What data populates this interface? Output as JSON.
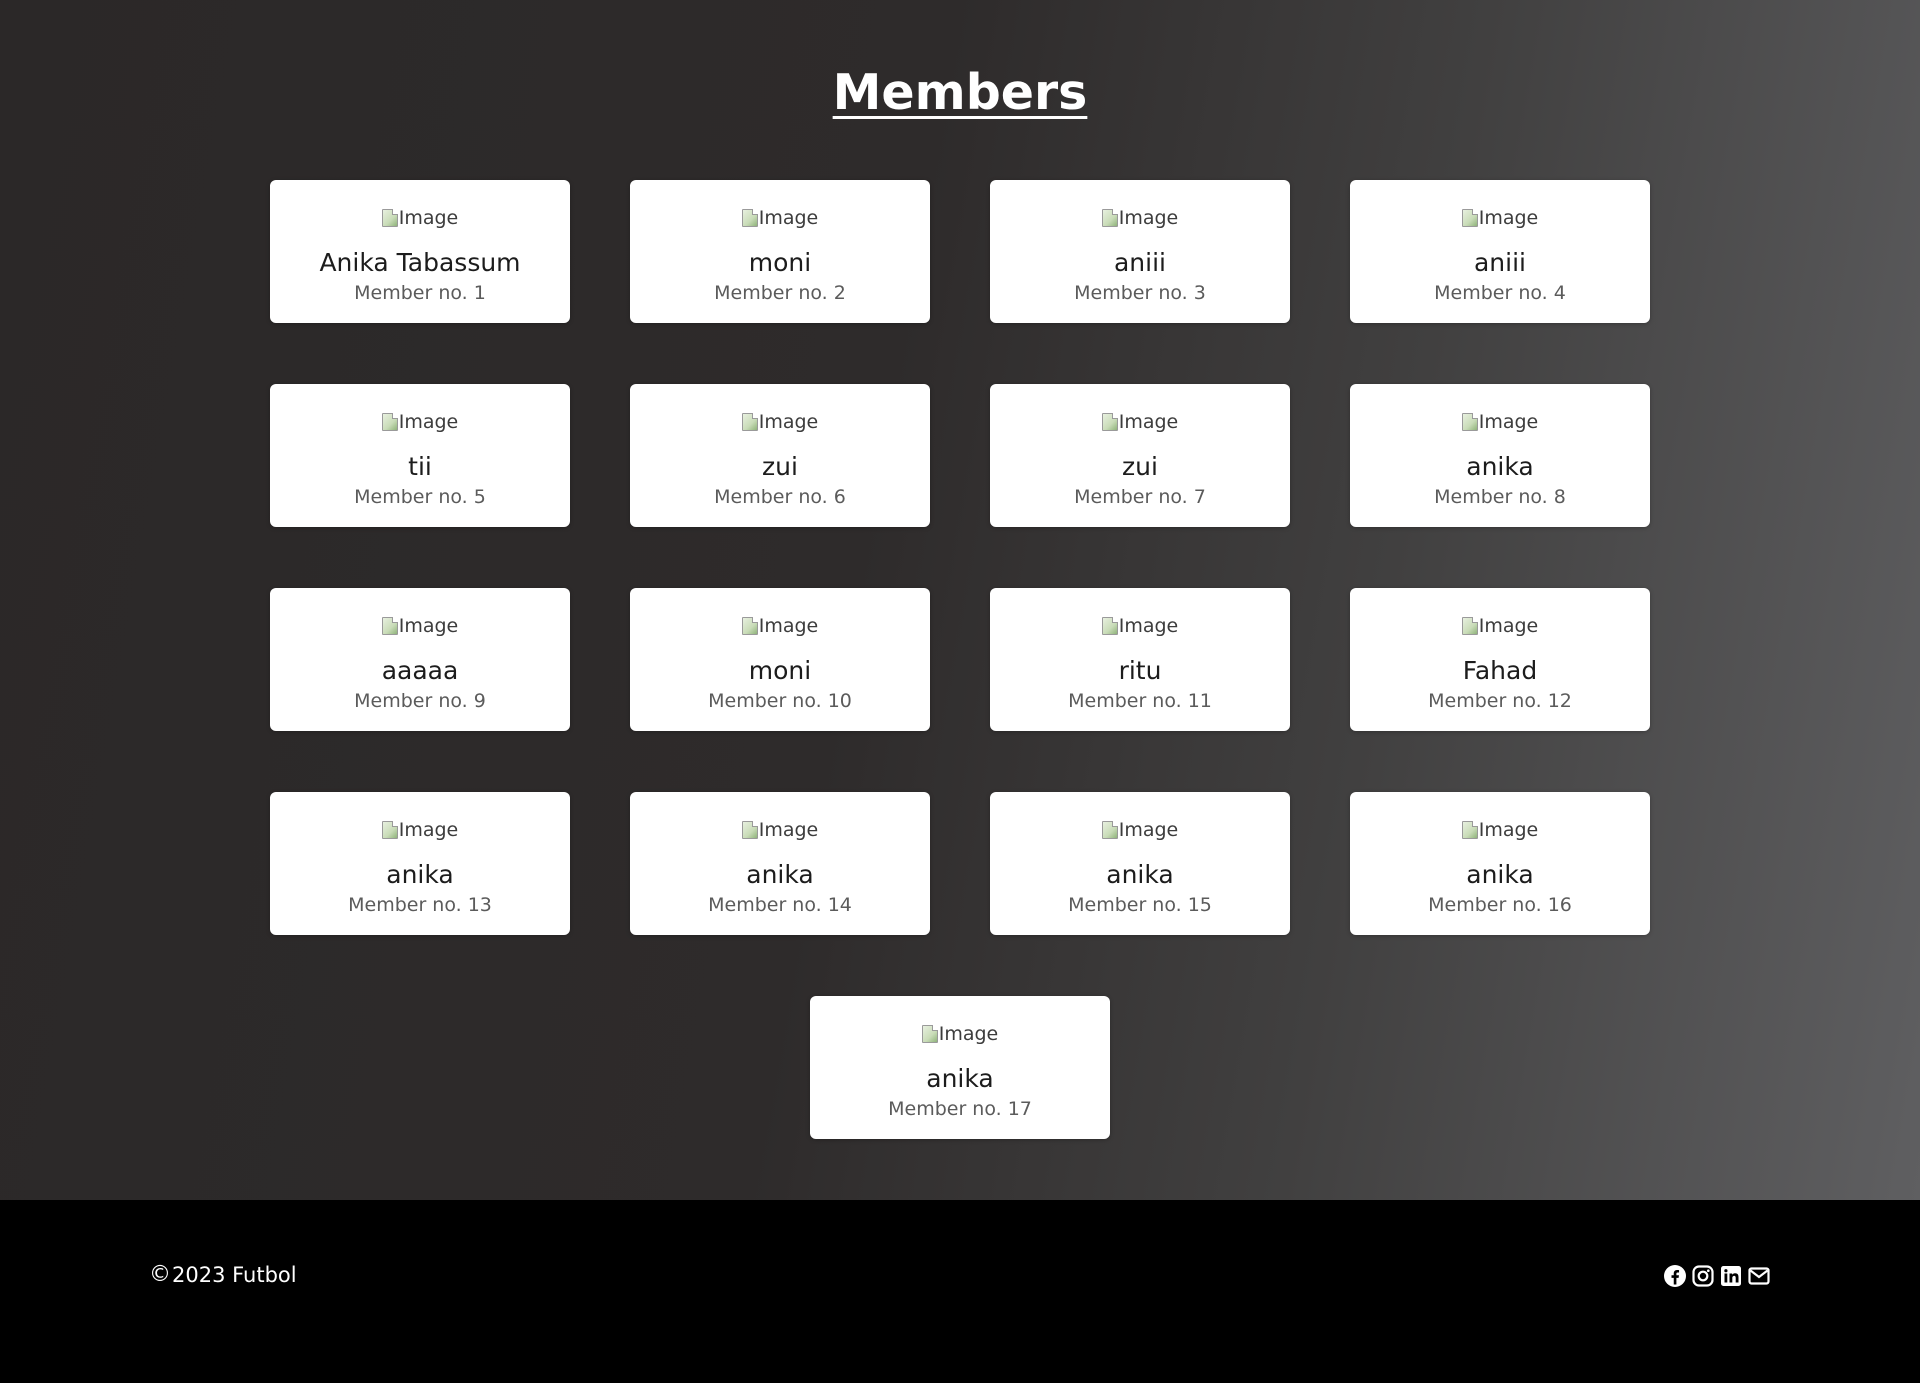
{
  "page": {
    "title": "Members"
  },
  "image_alt": "Image",
  "members": [
    {
      "name": "Anika Tabassum",
      "number": "Member no. 1"
    },
    {
      "name": "moni",
      "number": "Member no. 2"
    },
    {
      "name": "aniii",
      "number": "Member no. 3"
    },
    {
      "name": "aniii",
      "number": "Member no. 4"
    },
    {
      "name": "tii",
      "number": "Member no. 5"
    },
    {
      "name": "zui",
      "number": "Member no. 6"
    },
    {
      "name": "zui",
      "number": "Member no. 7"
    },
    {
      "name": "anika",
      "number": "Member no. 8"
    },
    {
      "name": "aaaaa",
      "number": "Member no. 9"
    },
    {
      "name": "moni",
      "number": "Member no. 10"
    },
    {
      "name": "ritu",
      "number": "Member no. 11"
    },
    {
      "name": "Fahad",
      "number": "Member no. 12"
    },
    {
      "name": "anika",
      "number": "Member no. 13"
    },
    {
      "name": "anika",
      "number": "Member no. 14"
    },
    {
      "name": "anika",
      "number": "Member no. 15"
    },
    {
      "name": "anika",
      "number": "Member no. 16"
    },
    {
      "name": "anika",
      "number": "Member no. 17"
    }
  ],
  "footer": {
    "copyright_symbol": "©",
    "copyright_text": "2023 Futbol",
    "social_icons": [
      "facebook-icon",
      "instagram-icon",
      "linkedin-icon",
      "envelope-icon"
    ]
  },
  "colors": {
    "footer_bg": "#000000",
    "card_bg": "#ffffff",
    "title": "#ffffff"
  }
}
